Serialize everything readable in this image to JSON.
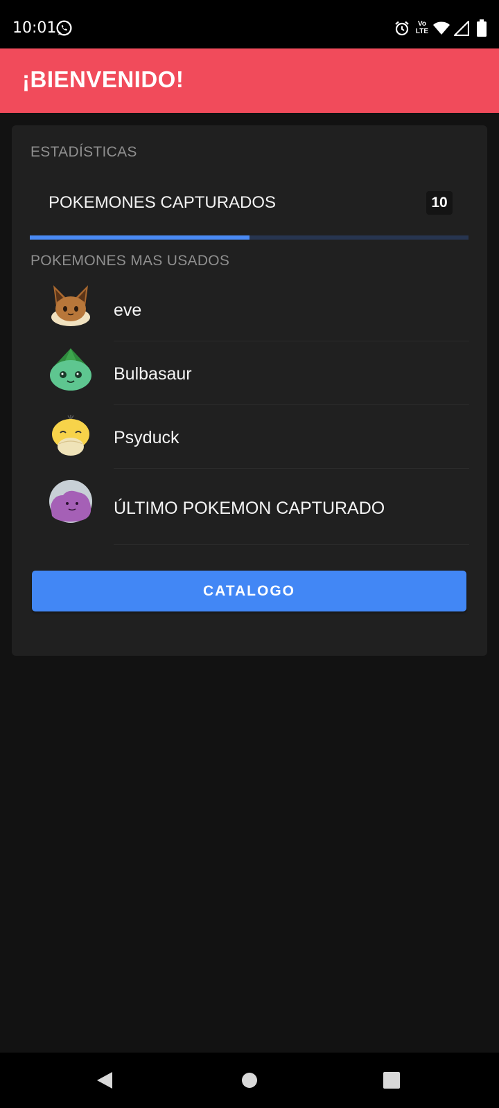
{
  "status_bar": {
    "time": "10:01",
    "icons": [
      "whatsapp-icon",
      "alarm-icon",
      "volte-icon",
      "wifi-icon",
      "signal-icon",
      "battery-icon"
    ],
    "volte_text": "Vo LTE"
  },
  "app_bar": {
    "title": "¡BIENVENIDO!",
    "color": "#f14b5b"
  },
  "stats": {
    "section_label": "ESTADÍSTICAS",
    "captured_label": "POKEMONES CAPTURADOS",
    "captured_count": "10",
    "progress_percent": 50,
    "progress_color": "#4a8af4"
  },
  "most_used": {
    "section_label": "POKEMONES MAS USADOS",
    "items": [
      {
        "name": "eve",
        "icon": "eevee-icon"
      },
      {
        "name": "Bulbasaur",
        "icon": "bulbasaur-icon"
      },
      {
        "name": "Psyduck",
        "icon": "psyduck-icon"
      },
      {
        "name": "ÚLTIMO POKEMON CAPTURADO",
        "icon": "ditto-icon"
      }
    ]
  },
  "catalog_button": {
    "label": "CATALOGO",
    "color": "#4287f5"
  },
  "nav_bar": {
    "buttons": [
      "back-icon",
      "home-icon",
      "recents-icon"
    ]
  }
}
